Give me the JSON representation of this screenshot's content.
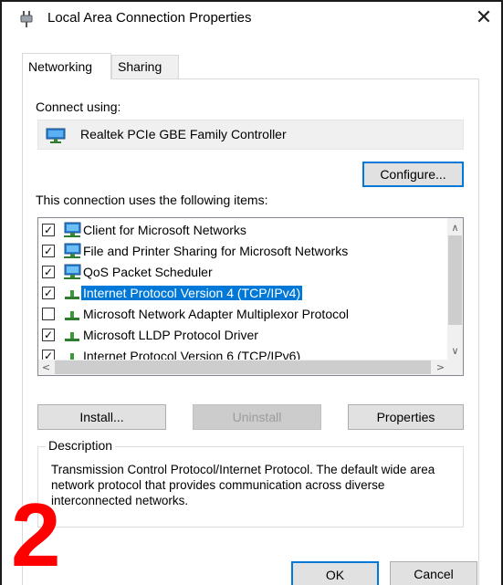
{
  "window": {
    "title": "Local Area Connection Properties",
    "close_glyph": "✕"
  },
  "tabs": [
    {
      "label": "Networking",
      "active": true
    },
    {
      "label": "Sharing",
      "active": false
    }
  ],
  "connect_using": {
    "label": "Connect using:",
    "adapter": "Realtek PCIe GBE Family Controller",
    "adapter_icon": "network-adapter-icon"
  },
  "buttons": {
    "configure": "Configure...",
    "install": "Install...",
    "uninstall": "Uninstall",
    "properties": "Properties",
    "ok": "OK",
    "cancel": "Cancel"
  },
  "items_label": "This connection uses the following items:",
  "items": [
    {
      "label": "Client for Microsoft Networks",
      "checked": true,
      "icon": "network-client-icon",
      "selected": false
    },
    {
      "label": "File and Printer Sharing for Microsoft Networks",
      "checked": true,
      "icon": "network-service-icon",
      "selected": false
    },
    {
      "label": "QoS Packet Scheduler",
      "checked": true,
      "icon": "network-service-icon",
      "selected": false
    },
    {
      "label": "Internet Protocol Version 4 (TCP/IPv4)",
      "checked": true,
      "icon": "network-protocol-icon",
      "selected": true
    },
    {
      "label": "Microsoft Network Adapter Multiplexor Protocol",
      "checked": false,
      "icon": "network-protocol-icon",
      "selected": false
    },
    {
      "label": "Microsoft LLDP Protocol Driver",
      "checked": true,
      "icon": "network-protocol-icon",
      "selected": false
    },
    {
      "label": "Internet Protocol Version 6 (TCP/IPv6)",
      "checked": true,
      "icon": "network-protocol-icon",
      "selected": false
    }
  ],
  "description": {
    "legend": "Description",
    "text": "Transmission Control Protocol/Internet Protocol. The default wide area network protocol that provides communication across diverse interconnected networks."
  },
  "annotation": {
    "number": "2",
    "color": "#ff0000"
  },
  "colors": {
    "selection": "#0078d7",
    "focus_border": "#0078d7"
  }
}
